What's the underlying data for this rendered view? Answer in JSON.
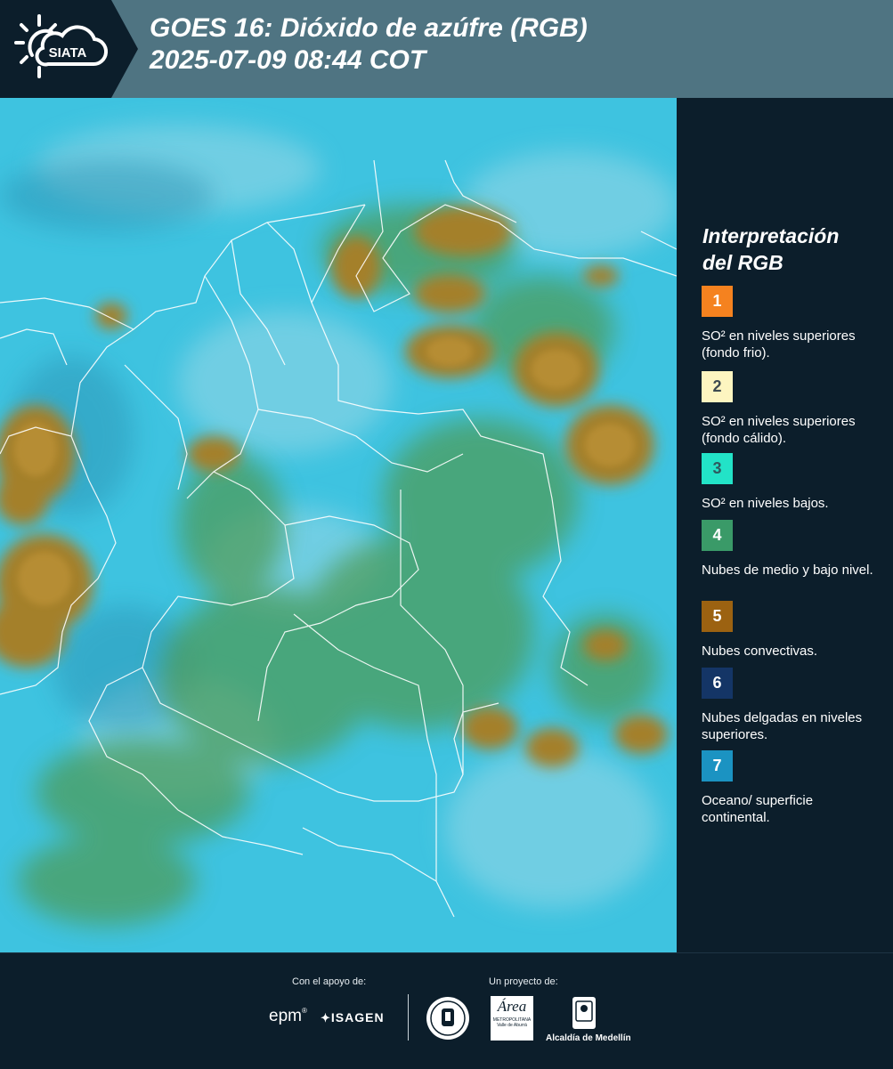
{
  "header": {
    "logo_text": "SIATA",
    "title": "GOES 16: Dióxido de azúfre (RGB)\n 2025-07-09 08:44 COT"
  },
  "map": {
    "ocean_color": "#3ec3e0",
    "cloud_convective_color": "#a4802a",
    "cloud_low_color": "#4e9a52",
    "boundary_color": "#ffffff"
  },
  "legend": {
    "title": "Interpretación\ndel RGB",
    "items": [
      {
        "number": "1",
        "color": "#f5821f",
        "number_color": "#ffffff",
        "label": "SO² en niveles superiores (fondo frio)."
      },
      {
        "number": "2",
        "color": "#fdf5c0",
        "number_color": "#3d4a50",
        "label": "SO² en niveles superiores (fondo cálido)."
      },
      {
        "number": "3",
        "color": "#22e3c7",
        "number_color": "#2e5a5e",
        "label": "SO² en niveles bajos."
      },
      {
        "number": "4",
        "color": "#3a9a68",
        "number_color": "#ffffff",
        "label": "Nubes de medio y bajo nivel."
      },
      {
        "number": "5",
        "color": "#9c6211",
        "number_color": "#ffffff",
        "label": "Nubes convectivas."
      },
      {
        "number": "6",
        "color": "#143566",
        "number_color": "#ffffff",
        "label": "Nubes delgadas en niveles superiores."
      },
      {
        "number": "7",
        "color": "#1b93c2",
        "number_color": "#ffffff",
        "label": "Oceano/ superficie continental."
      }
    ]
  },
  "footer": {
    "support_label": "Con el apoyo de:",
    "project_label": "Un proyecto de:",
    "sponsor_1": "epm",
    "sponsor_2": "ISAGEN",
    "partner_1": "Área",
    "partner_1_sub": "METROPOLITANA\nValle de Aburrá",
    "partner_2": "Alcaldía de Medellín"
  }
}
